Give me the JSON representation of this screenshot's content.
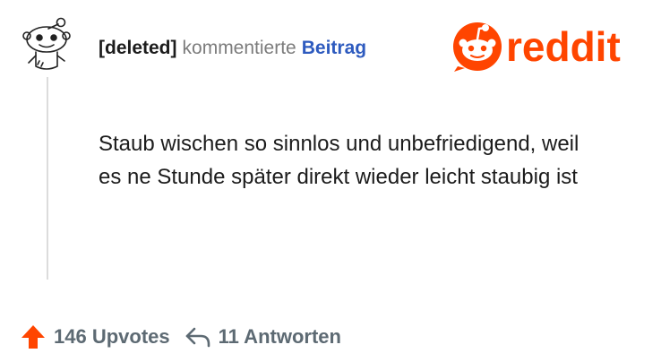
{
  "comment": {
    "author": "[deleted]",
    "action": "kommentierte",
    "post_link": "Beitrag",
    "body": "Staub wischen so sinnlos und unbefriedigend, weil es ne Stunde später direkt wieder leicht staubig ist"
  },
  "brand": {
    "name": "reddit",
    "color": "#ff4500"
  },
  "footer": {
    "upvotes_label": "146 Upvotes",
    "replies_label": "11 Antworten"
  },
  "icons": {
    "avatar": "snoo-avatar-icon",
    "upvote": "upvote-arrow-icon",
    "reply": "reply-arrow-icon",
    "logo": "reddit-snoo-logo-icon"
  },
  "colors": {
    "upvote_arrow": "#ff4500",
    "muted_text": "#5d6a73",
    "link": "#2e5bbf"
  }
}
